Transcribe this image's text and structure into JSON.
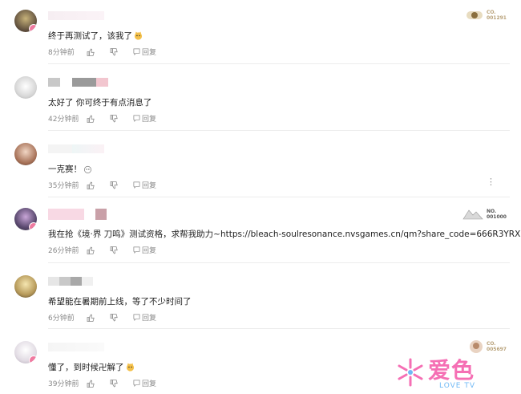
{
  "comments": [
    {
      "text": "终于再测试了，该我了",
      "time": "8分钟前",
      "reply": "回复",
      "badge": {
        "line1": "CO.",
        "line2": "001291"
      }
    },
    {
      "text": "太好了 你可终于有点消息了",
      "time": "42分钟前",
      "reply": "回复"
    },
    {
      "text": "一克赛！",
      "time": "35分钟前",
      "reply": "回复",
      "more": "⋮"
    },
    {
      "text": "我在抢《境·界 刀鸣》测试资格，求帮我助力~https://bleach-soulresonance.nvsgames.cn/qm?share_code=666R3YRX",
      "time": "26分钟前",
      "reply": "回复",
      "badge": {
        "line1": "NO.",
        "line2": "001000"
      }
    },
    {
      "text": "希望能在暑期前上线，等了不少时间了",
      "time": "6分钟前",
      "reply": "回复"
    },
    {
      "text": "懂了，到时候卍解了",
      "time": "39分钟前",
      "reply": "回复",
      "badge": {
        "line1": "CO.",
        "line2": "005697"
      }
    }
  ],
  "watermark": {
    "brand": "爱色",
    "sub": "LOVE TV"
  },
  "colors": {
    "meta": "#8a8a8a",
    "divider": "#ececec",
    "badge_text": "#b9a27a",
    "brand_pink": "#f56fb4",
    "brand_blue": "#6fb8f5"
  }
}
